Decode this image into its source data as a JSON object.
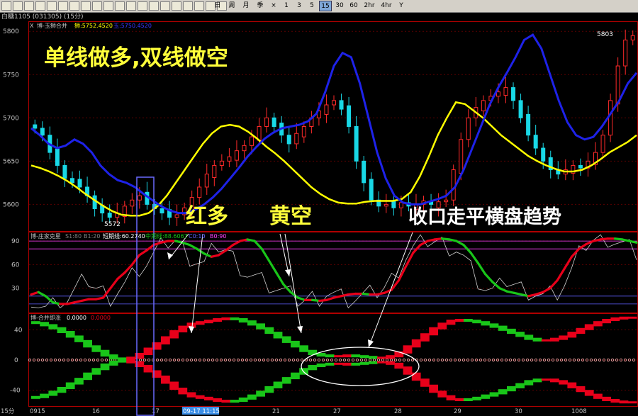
{
  "toolbar": {
    "periods": [
      "日",
      "周",
      "月",
      "季",
      "×",
      "1",
      "3",
      "5",
      "15",
      "30",
      "60",
      "2hr",
      "4hr",
      "Y"
    ],
    "active_period": "15"
  },
  "title_bar": "白糖1105 (031305) (15分)",
  "panel_main": {
    "legend_x": "X",
    "legend_name": "博-玉狮合并",
    "legend_a": "狮:5752.4520",
    "legend_b": "玉:5750.4520",
    "yaxis_ticks": [
      5600,
      5650,
      5700,
      5750,
      5800
    ],
    "price_high_label": "5803",
    "price_low_label": "5572",
    "annotation_main": "单线做多,双线做空",
    "annotation_red_long": "红多",
    "annotation_yellow_short": "黄空",
    "annotation_converge": "收口走平横盘趋势"
  },
  "panel_osc": {
    "legend_name": "博-庄家克星",
    "legend_s1": "S1:80",
    "legend_b1": "B1:20",
    "legend_short": "短期线:60.2740",
    "legend_mid": "中期线:88.6067",
    "legend_c": "C0:10",
    "legend_b0": "B0:90",
    "yaxis_ticks": [
      30,
      60,
      90
    ]
  },
  "panel_bottom": {
    "legend_name": "博-合并即涨",
    "legend_value": "0.0000",
    "legend_value2": "0.0000",
    "yaxis_ticks": [
      -40,
      0,
      40
    ]
  },
  "x_axis": {
    "labels": [
      "15分",
      "0915",
      "16",
      "17",
      "09-17 11:15",
      "21",
      "27",
      "28",
      "29",
      "30",
      "1008"
    ]
  },
  "colors": {
    "up": "#ff2a2a",
    "down": "#19d8e6",
    "yellow": "#ffff00",
    "blue": "#1e22e8",
    "green": "#19c519",
    "red": "#e8001a",
    "annotation": "#ffff3a"
  },
  "chart_data": [
    {
      "type": "candlestick",
      "panel": "main",
      "ylim": [
        5570,
        5810
      ],
      "close": [
        5688,
        5680,
        5660,
        5645,
        5630,
        5625,
        5620,
        5610,
        5595,
        5590,
        5585,
        5590,
        5598,
        5605,
        5610,
        5600,
        5595,
        5590,
        5585,
        5588,
        5596,
        5608,
        5620,
        5635,
        5645,
        5650,
        5655,
        5662,
        5668,
        5678,
        5690,
        5700,
        5690,
        5680,
        5670,
        5682,
        5690,
        5700,
        5708,
        5715,
        5720,
        5710,
        5690,
        5650,
        5625,
        5605,
        5598,
        5600,
        5596,
        5602,
        5598,
        5600,
        5604,
        5600,
        5603,
        5605,
        5640,
        5675,
        5700,
        5712,
        5720,
        5725,
        5730,
        5735,
        5720,
        5700,
        5680,
        5665,
        5650,
        5640,
        5635,
        5640,
        5645,
        5642,
        5650,
        5660,
        5680,
        5720,
        5760,
        5790,
        5795
      ],
      "yellow_line": [
        5645,
        5642,
        5638,
        5633,
        5627,
        5620,
        5612,
        5605,
        5598,
        5592,
        5588,
        5587,
        5587,
        5590,
        5598,
        5610,
        5625,
        5640,
        5655,
        5670,
        5682,
        5690,
        5692,
        5690,
        5684,
        5676,
        5667,
        5659,
        5650,
        5640,
        5630,
        5620,
        5612,
        5606,
        5602,
        5601,
        5601,
        5603,
        5604,
        5604,
        5604,
        5606,
        5614,
        5632,
        5655,
        5680,
        5700,
        5718,
        5716,
        5708,
        5700,
        5690,
        5680,
        5672,
        5664,
        5656,
        5650,
        5645,
        5641,
        5638,
        5638,
        5640,
        5645,
        5652,
        5660,
        5666,
        5672,
        5680
      ],
      "blue_line": [
        5688,
        5680,
        5670,
        5665,
        5668,
        5675,
        5670,
        5660,
        5645,
        5635,
        5628,
        5625,
        5620,
        5612,
        5605,
        5598,
        5593,
        5590,
        5590,
        5594,
        5600,
        5608,
        5618,
        5630,
        5642,
        5655,
        5666,
        5676,
        5683,
        5688,
        5690,
        5692,
        5696,
        5705,
        5730,
        5760,
        5775,
        5770,
        5740,
        5700,
        5660,
        5630,
        5610,
        5602,
        5600,
        5600,
        5603,
        5606,
        5610,
        5620,
        5640,
        5665,
        5690,
        5715,
        5735,
        5752,
        5770,
        5790,
        5796,
        5780,
        5750,
        5720,
        5695,
        5680,
        5675,
        5678,
        5690,
        5705,
        5720,
        5740,
        5752
      ]
    },
    {
      "type": "line",
      "panel": "oscillator",
      "ylim": [
        0,
        100
      ],
      "series": [
        {
          "name": "短期线",
          "values": [
            20,
            10,
            5,
            8,
            12,
            15,
            25,
            35,
            40,
            30,
            25,
            20,
            28,
            35,
            45,
            55,
            60,
            70,
            80,
            88,
            90,
            80,
            70,
            65,
            60,
            75,
            85,
            80,
            70,
            60,
            50,
            45,
            40,
            35,
            30,
            25,
            20,
            15,
            15,
            18,
            20,
            25,
            22,
            18,
            15,
            16,
            18,
            20,
            25,
            30,
            40,
            55,
            70,
            80,
            88,
            92,
            90,
            88,
            85,
            82,
            70,
            55,
            40,
            30,
            25,
            30,
            40,
            35,
            30,
            28,
            25,
            20,
            22,
            25,
            35,
            50,
            70,
            85,
            90,
            92,
            94,
            90,
            85,
            80,
            75
          ]
        },
        {
          "name": "中期线",
          "values": [
            22,
            25,
            20,
            12,
            10,
            10,
            12,
            14,
            16,
            16,
            18,
            30,
            42,
            50,
            60,
            72,
            78,
            85,
            88,
            90,
            90,
            88,
            85,
            80,
            74,
            70,
            72,
            78,
            85,
            90,
            92,
            90,
            80,
            65,
            50,
            35,
            25,
            18,
            15,
            15,
            14,
            15,
            18,
            20,
            22,
            23,
            23,
            22,
            22,
            24,
            28,
            40,
            58,
            75,
            85,
            90,
            92,
            93,
            92,
            90,
            85,
            75,
            62,
            48,
            38,
            30,
            26,
            24,
            22,
            20,
            22,
            25,
            30,
            40,
            55,
            70,
            80,
            86,
            90,
            92,
            93,
            93,
            92,
            90,
            88
          ]
        }
      ]
    },
    {
      "type": "line",
      "panel": "bottom",
      "ylim": [
        -60,
        60
      ],
      "series": [
        {
          "name": "上轨",
          "values": [
            50,
            49,
            46,
            42,
            37,
            31,
            25,
            18,
            12,
            6,
            2,
            0,
            3,
            8,
            15,
            22,
            30,
            38,
            44,
            48,
            50,
            52,
            54,
            55,
            54,
            51,
            47,
            42,
            36,
            30,
            24,
            18,
            12,
            8,
            6,
            5,
            5,
            6,
            5,
            4,
            3,
            3,
            5,
            10,
            18,
            26,
            34,
            42,
            48,
            52,
            53,
            52,
            50,
            47,
            44,
            40,
            36,
            32,
            28,
            26,
            26,
            28,
            31,
            36,
            41,
            46,
            50,
            53,
            55,
            56,
            56
          ]
        },
        {
          "name": "下轨",
          "values": [
            -50,
            -49,
            -46,
            -42,
            -37,
            -31,
            -25,
            -18,
            -12,
            -6,
            -2,
            0,
            -3,
            -8,
            -15,
            -22,
            -30,
            -38,
            -44,
            -48,
            -50,
            -52,
            -54,
            -55,
            -54,
            -51,
            -47,
            -42,
            -36,
            -30,
            -24,
            -18,
            -12,
            -8,
            -6,
            -5,
            -5,
            -6,
            -5,
            -4,
            -3,
            -3,
            -5,
            -10,
            -18,
            -26,
            -34,
            -42,
            -48,
            -52,
            -53,
            -52,
            -50,
            -47,
            -44,
            -40,
            -36,
            -32,
            -28,
            -26,
            -26,
            -28,
            -31,
            -36,
            -41,
            -46,
            -50,
            -53,
            -55,
            -56,
            -56
          ]
        }
      ]
    }
  ]
}
